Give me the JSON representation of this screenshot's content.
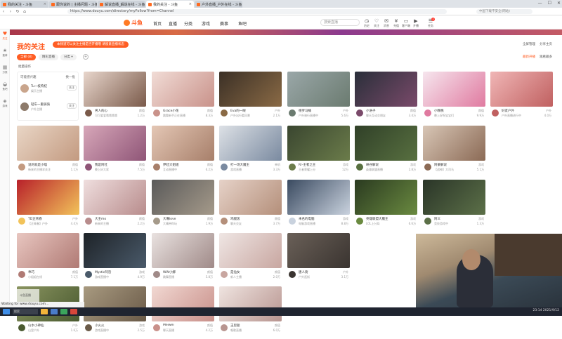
{
  "browser": {
    "tabs": [
      {
        "title": "我的关注 - 斗鱼",
        "active": false
      },
      {
        "title": "跟你说的 | 主播问题 - 斗鱼",
        "active": false
      },
      {
        "title": "解说直播_解说在线 - 斗鱼直播",
        "active": false
      },
      {
        "title": "我的关注 - 斗鱼",
        "active": true
      },
      {
        "title": "户外直播_户外在线 - 斗鱼直播",
        "active": false
      }
    ],
    "url": "https://www.douyu.com/directory/myFollow?from=Channel",
    "search_placeholder": "中国下载不安全(网站)",
    "nav_icons": [
      "back-icon",
      "forward-icon",
      "refresh-icon",
      "home-icon"
    ]
  },
  "site": {
    "logo": "斗鱼",
    "nav": [
      {
        "label": "首页"
      },
      {
        "label": "直播"
      },
      {
        "label": "分类",
        "caret": true
      },
      {
        "label": "游戏",
        "caret": true
      },
      {
        "label": "赛事",
        "caret": true
      },
      {
        "label": "鱼吧"
      }
    ],
    "search_placeholder": "搜索直播",
    "header_icons": [
      {
        "label": "历史",
        "icon": "history-icon"
      },
      {
        "label": "关注",
        "icon": "follow-icon"
      },
      {
        "label": "消息",
        "icon": "message-icon"
      },
      {
        "label": "充值",
        "icon": "recharge-icon"
      },
      {
        "label": "客户端",
        "icon": "client-icon"
      },
      {
        "label": "开播",
        "icon": "start-live-icon"
      },
      {
        "label": "任务",
        "icon": "task-icon"
      }
    ],
    "header_badge": "1"
  },
  "sidebar": {
    "items": [
      {
        "label": "关注",
        "icon": "heart-icon",
        "active": true
      },
      {
        "label": "推荐",
        "icon": "star-icon",
        "active": false
      },
      {
        "label": "分类",
        "icon": "grid-icon",
        "active": false
      },
      {
        "label": "鱼吧",
        "icon": "fish-icon",
        "active": false
      },
      {
        "label": "游戏",
        "icon": "gamepad-icon",
        "active": false
      }
    ],
    "bottom_label": "菜单"
  },
  "page": {
    "title": "我的关注",
    "notice": "本频道可以关注主播是否开播哦 请留意直播状态",
    "right_tools": [
      "全屏管理",
      "分享主页"
    ],
    "filters": [
      {
        "label": "全部 (8)",
        "active": true
      },
      {
        "label": "精彩直播",
        "active": false
      },
      {
        "label": "分类 ▾",
        "active": false
      }
    ],
    "settings_glyph": "+",
    "batch_label": "批量操作",
    "sort_options": [
      {
        "label": "最新开播",
        "active": true
      },
      {
        "label": "观看最多",
        "active": false
      }
    ]
  },
  "follow_panel": {
    "title": "可能感兴趣",
    "link": "换一批",
    "rows": [
      {
        "name": "Tu一枝枸杞",
        "sub": "娱乐主播",
        "btn": "关注"
      },
      {
        "name": "轻车一重骑骑",
        "sub": "户外主播",
        "btn": "关注"
      }
    ]
  },
  "cards": [
    {
      "name": "男人的心",
      "tag": "颜值",
      "desc": "可可爱爱哦哦哦哦",
      "heat": "1.2万"
    },
    {
      "name": "Grace小花",
      "tag": "颜值",
      "desc": "跳舞新手正在直播",
      "heat": "8.3万"
    },
    {
      "name": "Eva的一眼",
      "tag": "户外",
      "desc": "户外出行看风景",
      "heat": "2.1万"
    },
    {
      "name": "德罗马桶",
      "tag": "户外",
      "desc": "户外骑行直播中",
      "heat": "5.6万"
    },
    {
      "name": "小浩子",
      "tag": "颜值",
      "desc": "聊天互动交朋友",
      "heat": "3.4万"
    },
    {
      "name": "小晚晚",
      "tag": "颜值",
      "desc": "晚上好呀宝宝们",
      "heat": "9.9万"
    },
    {
      "name": "好友户外",
      "tag": "户外",
      "desc": "户外直播进行中",
      "heat": "4.0万"
    },
    {
      "name": "说的就是小喵",
      "tag": "颜值",
      "desc": "新来的主播求关注",
      "heat": "1.1万"
    },
    {
      "name": "我是阿杜",
      "tag": "颜值",
      "desc": "晚上好大家",
      "heat": "7.5万"
    },
    {
      "name": "伊娃大姐姐",
      "tag": "颜值",
      "desc": "互动直播中",
      "heat": "6.2万"
    },
    {
      "name": "打一场大魔王",
      "tag": "单机",
      "desc": "游戏直播",
      "heat": "3.3万"
    },
    {
      "name": "Rr-王者之王",
      "tag": "游戏",
      "desc": "王者荣耀上分",
      "heat": "12万"
    },
    {
      "name": "峡谷解说",
      "tag": "游戏",
      "desc": "英雄联盟直播",
      "heat": "2.8万"
    },
    {
      "name": "阿豪解说",
      "tag": "游戏",
      "desc": "【战神】大司马",
      "heat": "5.1万"
    },
    {
      "name": "TD正青春",
      "tag": "户外",
      "desc": "【正青春】户外",
      "heat": "4.4万"
    },
    {
      "name": "大王mo",
      "tag": "颜值",
      "desc": "新来的主播",
      "heat": "2.2万"
    },
    {
      "name": "大嘴love",
      "tag": "颜值",
      "desc": "大嘴带你玩",
      "heat": "1.9万"
    },
    {
      "name": "鸡腿饭",
      "tag": "颜值",
      "desc": "聊天交友",
      "heat": "3.7万"
    },
    {
      "name": "未名的电脑",
      "tag": "游戏",
      "desc": "电脑游戏直播",
      "heat": "8.8万"
    },
    {
      "name": "英雄联盟大魔王",
      "tag": "游戏",
      "desc": "LOL上分局",
      "heat": "6.6万"
    },
    {
      "name": "阿三",
      "tag": "游戏",
      "desc": "竞技游戏中",
      "heat": "1.3万"
    },
    {
      "name": "乖巧",
      "tag": "颜值",
      "desc": "小姐姐在线",
      "heat": "7.1万"
    },
    {
      "name": "Mystic阿哲",
      "tag": "游戏",
      "desc": "游戏直播中",
      "heat": "4.9万"
    },
    {
      "name": "WW小娜",
      "tag": "颜值",
      "desc": "跳舞直播",
      "heat": "5.8万"
    },
    {
      "name": "是仙女",
      "tag": "颜值",
      "desc": "新人主播",
      "heat": "2.0万"
    },
    {
      "name": "唐人街",
      "tag": "户外",
      "desc": "户外逛街",
      "heat": "3.1万"
    },
    {
      "name": "山水小神仙",
      "tag": "户外",
      "desc": "山里户外",
      "heat": "1.6万"
    },
    {
      "name": "小火火",
      "tag": "游戏",
      "desc": "游戏直播中",
      "heat": "2.5万"
    },
    {
      "name": "Meiwei",
      "tag": "颜值",
      "desc": "聊天直播",
      "heat": "4.2万"
    },
    {
      "name": "王思聪",
      "tag": "颜值",
      "desc": "唱歌直播",
      "heat": "6.0万"
    }
  ],
  "status_text": "Waiting for www.douyu.com...",
  "watermark": "斗鱼直播",
  "taskbar": {
    "search": "搜索",
    "tray": "23:14 2021/9/12"
  }
}
